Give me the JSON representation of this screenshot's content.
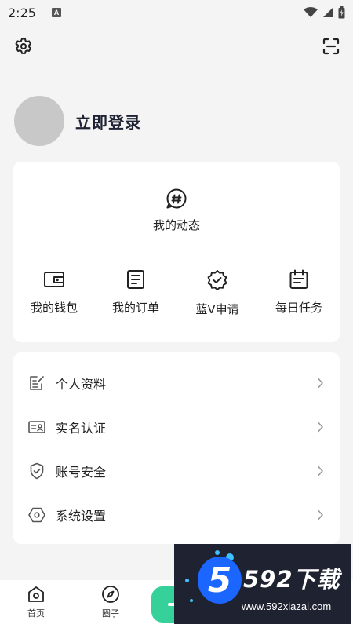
{
  "status_bar": {
    "time": "2:25",
    "a_badge": "A"
  },
  "top": {
    "settings_icon": "gear-icon",
    "scan_icon": "scan-icon"
  },
  "profile": {
    "login_label": "立即登录"
  },
  "feed": {
    "label": "我的动态",
    "icon": "hash-chat-icon"
  },
  "quick_actions": [
    {
      "label": "我的钱包",
      "icon": "wallet-icon"
    },
    {
      "label": "我的订单",
      "icon": "order-list-icon"
    },
    {
      "label": "蓝V申请",
      "icon": "verified-badge-icon"
    },
    {
      "label": "每日任务",
      "icon": "calendar-task-icon"
    }
  ],
  "menu": [
    {
      "label": "个人资料",
      "icon": "edit-profile-icon"
    },
    {
      "label": "实名认证",
      "icon": "id-card-icon"
    },
    {
      "label": "账号安全",
      "icon": "shield-icon"
    },
    {
      "label": "系统设置",
      "icon": "hexagon-settings-icon"
    }
  ],
  "tabbar": {
    "home_label": "首页",
    "circle_label": "圈子",
    "fab_color": "#36d19a"
  },
  "watermark": {
    "badge": "5",
    "title": "592下载",
    "url": "www.592xiazai.com"
  },
  "colors": {
    "accent": "#36d19a",
    "background": "#f4f4f4",
    "title": "#1e2233"
  }
}
